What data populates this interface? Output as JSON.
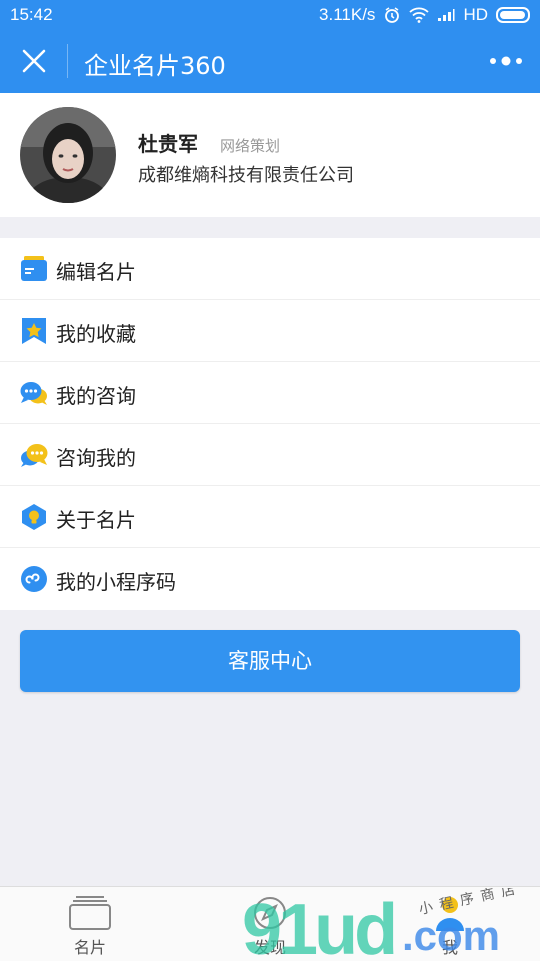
{
  "status_bar": {
    "time": "15:42",
    "network_speed": "3.11K/s",
    "network_type": "HD",
    "battery_level": 0.95
  },
  "nav": {
    "title": "企业名片360"
  },
  "profile": {
    "name": "杜贵军",
    "title": "网络策划",
    "company": "成都维熵科技有限责任公司"
  },
  "menu": {
    "items": [
      {
        "label": "编辑名片",
        "icon": "edit-card-icon",
        "color": "#2f8ff0"
      },
      {
        "label": "我的收藏",
        "icon": "favorites-star-icon",
        "color": "#2f8ff0"
      },
      {
        "label": "我的咨询",
        "icon": "chat-bubbles-icon",
        "color": "#2f8ff0"
      },
      {
        "label": "咨询我的",
        "icon": "chat-bubbles-reverse-icon",
        "color": "#f3c11a"
      },
      {
        "label": "关于名片",
        "icon": "hexagon-bulb-icon",
        "color": "#2f8ff0"
      },
      {
        "label": "我的小程序码",
        "icon": "mini-program-code-icon",
        "color": "#2f8ff0"
      }
    ]
  },
  "customer_service_button": {
    "label": "客服中心"
  },
  "tabbar": {
    "tabs": [
      {
        "label": "名片",
        "icon": "card-stack-icon"
      },
      {
        "label": "发现",
        "icon": "discover-icon"
      },
      {
        "label": "我",
        "icon": "person-icon"
      }
    ]
  },
  "watermark": {
    "brand": "91ud",
    "domain": ".com",
    "slogan": "小程序商店"
  },
  "colors": {
    "primary": "#2f8ff0",
    "accent_yellow": "#f3c11a",
    "page_bg": "#efeff4"
  }
}
